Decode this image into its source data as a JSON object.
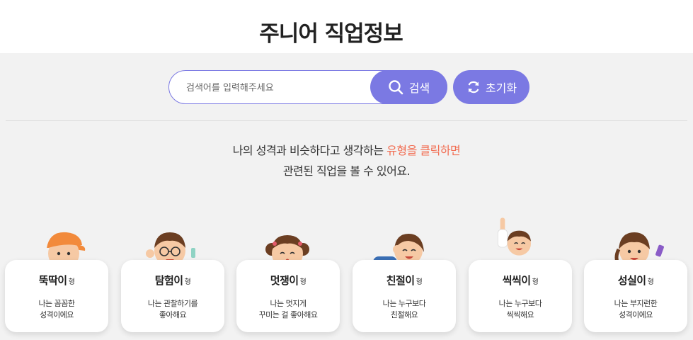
{
  "header": {
    "title": "주니어 직업정보"
  },
  "search": {
    "placeholder": "검색어를 입력해주세요",
    "value": "",
    "search_label": "검색",
    "reset_label": "초기화",
    "search_icon": "search-icon",
    "reset_icon": "refresh-icon"
  },
  "intro": {
    "line1_prefix": "나의 성격과 비슷하다고 생각하는 ",
    "line1_highlight": "유형을 클릭하면",
    "line2": "관련된 직업을 볼 수 있어요."
  },
  "colors": {
    "accent": "#7b79e3",
    "highlight": "#f26d52"
  },
  "types": [
    {
      "name": "뚝딱이",
      "suffix": "형",
      "desc1": "나는 꼼꼼한",
      "desc2": "성격이에요"
    },
    {
      "name": "탐험이",
      "suffix": "형",
      "desc1": "나는 관찰하기를",
      "desc2": "좋아해요"
    },
    {
      "name": "멋쟁이",
      "suffix": "형",
      "desc1": "나는 멋지게",
      "desc2": "꾸미는 걸 좋아해요"
    },
    {
      "name": "친절이",
      "suffix": "형",
      "desc1": "나는 누구보다",
      "desc2": "친절해요"
    },
    {
      "name": "씩씩이",
      "suffix": "형",
      "desc1": "나는 누구보다",
      "desc2": "씩씩해요"
    },
    {
      "name": "성실이",
      "suffix": "형",
      "desc1": "나는 부지런한",
      "desc2": "성격이에요"
    }
  ]
}
